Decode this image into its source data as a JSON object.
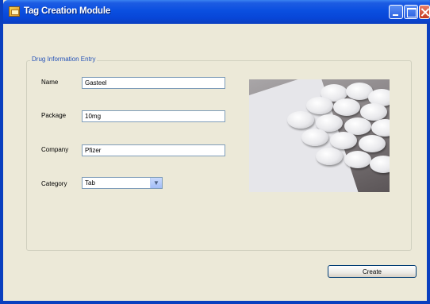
{
  "window": {
    "title": "Tag Creation Module"
  },
  "group": {
    "legend": "Drug Information Entry"
  },
  "form": {
    "name_label": "Name",
    "name_value": "Gasteel",
    "package_label": "Package",
    "package_value": "10mg",
    "company_label": "Company",
    "company_value": "Pfizer",
    "category_label": "Category",
    "category_value": "Tab"
  },
  "buttons": {
    "create_label": "Create"
  },
  "colors": {
    "titlebar": "#0a4fe0",
    "window_bg": "#ece9d8",
    "legend_text": "#2452b8"
  },
  "icons": {
    "app": "tag-app-icon",
    "minimize": "minimize-icon",
    "maximize": "maximize-icon",
    "close": "close-icon",
    "dropdown": "chevron-down-icon"
  }
}
